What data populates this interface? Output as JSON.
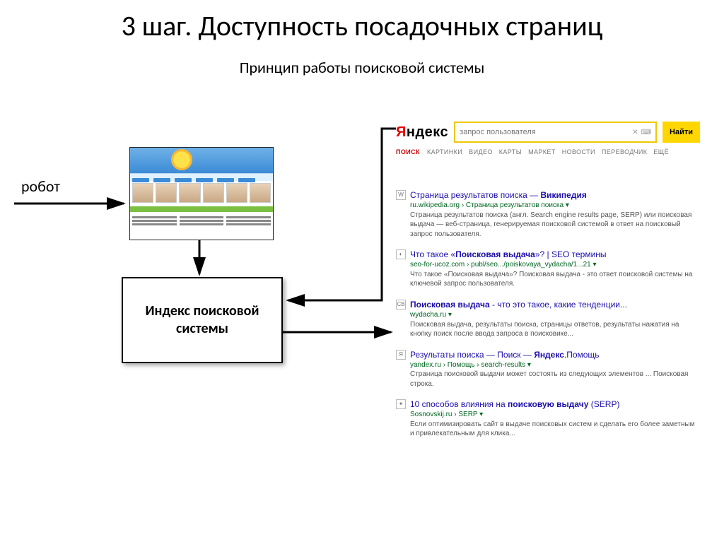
{
  "title": "3 шаг. Доступность посадочных страниц",
  "subtitle": "Принцип работы поисковой системы",
  "robot_label": "робот",
  "index_box": "Индекс поисковой системы",
  "yandex": {
    "logo_red": "Я",
    "logo_black": "ндекс",
    "query": "запрос пользователя",
    "find": "Найти",
    "tabs": {
      "active": "ПОИСК",
      "rest": [
        "КАРТИНКИ",
        "ВИДЕО",
        "КАРТЫ",
        "МАРКЕТ",
        "НОВОСТИ",
        "ПЕРЕВОДЧИК",
        "ЕЩЁ"
      ]
    }
  },
  "results": [
    {
      "fav": "W",
      "title_pre": "Страница результатов поиска — ",
      "title_bold": "Википедия",
      "url": "ru.wikipedia.org › Страница результатов поиска ▾",
      "snip": "Страница результатов поиска (англ. Search engine results page, SERP) или поисковая выдача — веб-страница, генерируемая поисковой системой в ответ на поисковый запрос пользователя."
    },
    {
      "fav": "◐",
      "title_pre": "Что такое «",
      "title_bold": "Поисковая выдача",
      "title_post": "»? | SEO термины",
      "url": "seo-for-ucoz.com › publ/seo.../poiskovaya_vydacha/1...21 ▾",
      "snip": "Что такое «Поисковая выдача»? Поисковая выдача - это ответ поисковой системы на ключевой запрос пользователя."
    },
    {
      "fav": "СВ",
      "title_pre": "",
      "title_bold": "Поисковая выдача",
      "title_post": " - что это такое, какие тенденции...",
      "url": "wydacha.ru ▾",
      "snip": "Поисковая выдача, результаты поиска, страницы ответов, результаты нажатия на кнопку поиск после ввода запроса в поисковике..."
    },
    {
      "fav": "Я",
      "title_pre": "Результаты поиска — Поиск — ",
      "title_bold": "Яндекс",
      "title_post": ".Помощь",
      "url": "yandex.ru › Помощь › search-results ▾",
      "snip": "Страница поисковой выдачи может состоять из следующих элементов ... Поисковая строка."
    },
    {
      "fav": "✦",
      "title_pre": "10 способов влияния на ",
      "title_bold": "поисковую выдачу",
      "title_post": " (SERP)",
      "url": "Sosnovskij.ru › SERP ▾",
      "snip": "Если оптимизировать сайт в выдаче поисковых систем и сделать его более заметным и привлекательным для клика..."
    }
  ]
}
